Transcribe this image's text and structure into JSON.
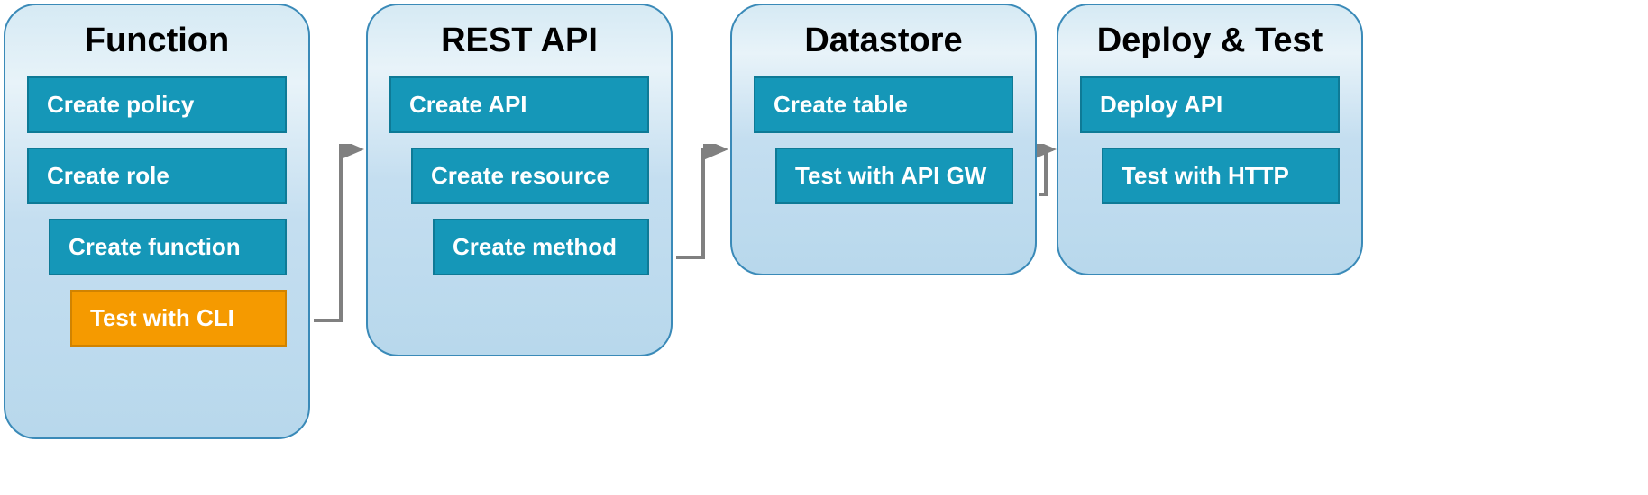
{
  "stages": [
    {
      "id": "function",
      "title": "Function",
      "steps": [
        {
          "label": "Create policy",
          "indent": 0,
          "color": "teal"
        },
        {
          "label": "Create role",
          "indent": 0,
          "color": "teal"
        },
        {
          "label": "Create function",
          "indent": 1,
          "color": "teal"
        },
        {
          "label": "Test with CLI",
          "indent": 2,
          "color": "orange"
        }
      ]
    },
    {
      "id": "restapi",
      "title": "REST API",
      "steps": [
        {
          "label": "Create API",
          "indent": 0,
          "color": "teal"
        },
        {
          "label": "Create resource",
          "indent": 1,
          "color": "teal"
        },
        {
          "label": "Create method",
          "indent": 2,
          "color": "teal"
        }
      ]
    },
    {
      "id": "datastore",
      "title": "Datastore",
      "steps": [
        {
          "label": "Create table",
          "indent": 0,
          "color": "teal"
        },
        {
          "label": "Test with API GW",
          "indent": 1,
          "color": "teal"
        }
      ]
    },
    {
      "id": "deploy",
      "title": "Deploy & Test",
      "steps": [
        {
          "label": "Deploy API",
          "indent": 0,
          "color": "teal"
        },
        {
          "label": "Test with HTTP",
          "indent": 1,
          "color": "teal"
        }
      ]
    }
  ],
  "colors": {
    "teal_fill": "#1597b8",
    "teal_border": "#0e7a96",
    "orange_fill": "#f59a00",
    "orange_border": "#d18300",
    "box_border": "#3a8ab8",
    "arrow": "#808080"
  }
}
